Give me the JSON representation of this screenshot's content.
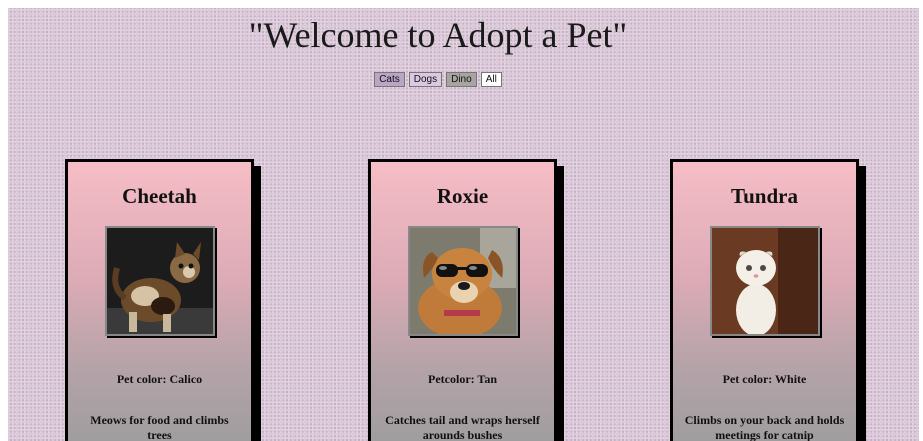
{
  "page": {
    "title": "\"Welcome to Adopt a Pet\""
  },
  "filters": [
    {
      "label": "Cats",
      "color": "#bba5c4"
    },
    {
      "label": "Dogs",
      "color": "#ddc8e2"
    },
    {
      "label": "Dino",
      "color": "#a7a4a2"
    },
    {
      "label": "All",
      "color": "#ffffff"
    }
  ],
  "pets": [
    {
      "name": "Cheetah",
      "color": "Pet color: Calico",
      "description": "Meows for food and climbs trees",
      "image": "calico-kitten"
    },
    {
      "name": "Roxie",
      "color": "Petcolor: Tan",
      "description": "Catches tail and wraps herself arounds bushes",
      "image": "dog-with-sunglasses"
    },
    {
      "name": "Tundra",
      "color": "Pet color: White",
      "description": "Climbs on your back and holds meetings for catnip",
      "image": "white-kitten"
    }
  ]
}
